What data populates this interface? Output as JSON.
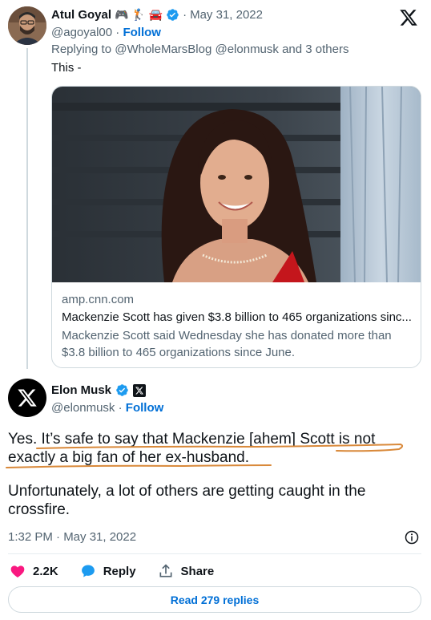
{
  "reply_tweet": {
    "author_name": "Atul Goyal",
    "name_emojis": "🎮 🏌 🚘",
    "date": "May 31, 2022",
    "handle": "@agoyal00",
    "follow_label": "Follow",
    "replying_to": "Replying to @WholeMarsBlog @elonmusk and 3 others",
    "text": "This -",
    "link_card": {
      "domain": "amp.cnn.com",
      "title": "Mackenzie Scott has given $3.8 billion to 465 organizations sinc...",
      "description": "Mackenzie Scott said Wednesday she has donated more than $3.8 billion to 465 organizations since June."
    }
  },
  "main_tweet": {
    "author_name": "Elon Musk",
    "handle": "@elonmusk",
    "follow_label": "Follow",
    "paragraph1": "Yes. It’s safe to say that Mackenzie [ahem] Scott is not exactly a big fan of her ex-husband.",
    "paragraph2": "Unfortunately, a lot of others are getting caught in the crossfire.",
    "timestamp": "1:32 PM · May 31, 2022"
  },
  "actions": {
    "like_count": "2.2K",
    "reply_label": "Reply",
    "share_label": "Share"
  },
  "read_replies_label": "Read 279 replies",
  "colors": {
    "verified_blue": "#1d9bf0",
    "like_pink": "#f91880",
    "link_blue": "#006fd6",
    "annotation_orange": "#d9893a"
  }
}
